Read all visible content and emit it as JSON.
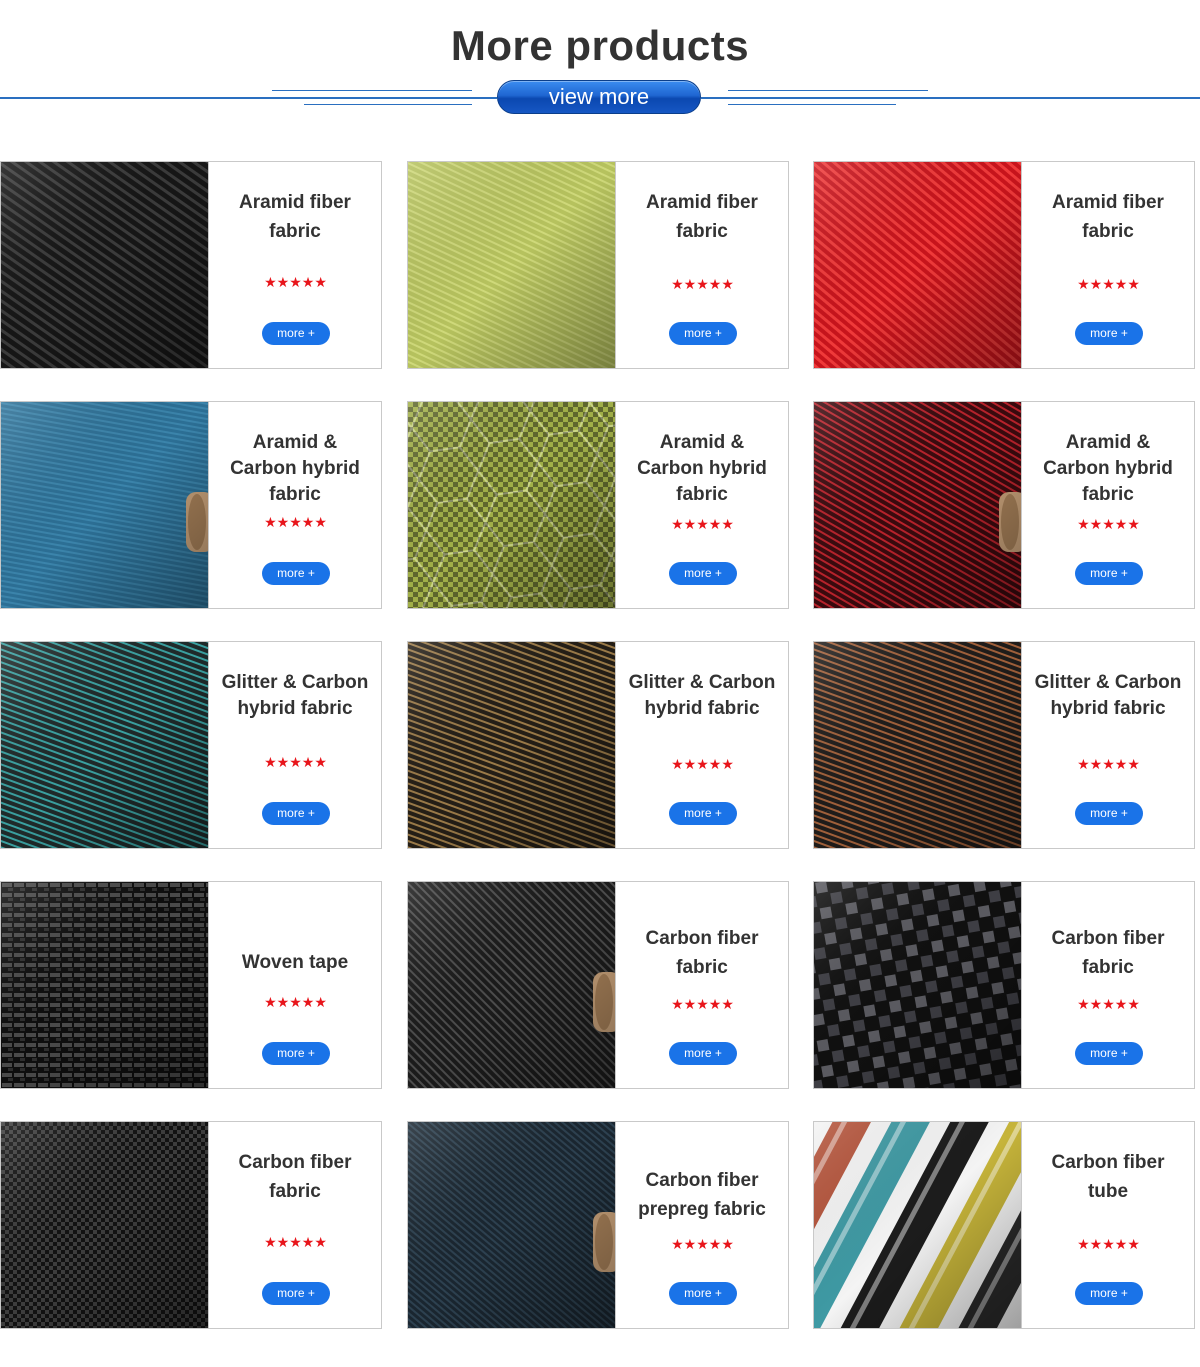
{
  "header": {
    "title": "More products",
    "view_more_label": "view more",
    "accent_color": "#2a6fc0"
  },
  "products": [
    {
      "name": "Aramid fiber fabric",
      "rating_stars": "★★★★★",
      "more_label": "more +",
      "swatch": "black-carbon-twill"
    },
    {
      "name": "Aramid fiber fabric",
      "rating_stars": "★★★★★",
      "more_label": "more +",
      "swatch": "yellow-green-aramid"
    },
    {
      "name": "Aramid fiber fabric",
      "rating_stars": "★★★★★",
      "more_label": "more +",
      "swatch": "red-aramid-twill"
    },
    {
      "name": "Aramid & Carbon hybrid fabric",
      "rating_stars": "★★★★★",
      "more_label": "more +",
      "swatch": "blue-hybrid-roll"
    },
    {
      "name": "Aramid & Carbon hybrid fabric",
      "rating_stars": "★★★★★",
      "more_label": "more +",
      "swatch": "yellow-hexagon-hybrid"
    },
    {
      "name": "Aramid & Carbon hybrid fabric",
      "rating_stars": "★★★★★",
      "more_label": "more +",
      "swatch": "red-black-hybrid-roll"
    },
    {
      "name": "Glitter & Carbon hybrid fabric",
      "rating_stars": "★★★★★",
      "more_label": "more +",
      "swatch": "teal-glitter-roll"
    },
    {
      "name": "Glitter & Carbon hybrid fabric",
      "rating_stars": "★★★★★",
      "more_label": "more +",
      "swatch": "gold-glitter-roll"
    },
    {
      "name": "Glitter & Carbon hybrid fabric",
      "rating_stars": "★★★★★",
      "more_label": "more +",
      "swatch": "copper-glitter-roll"
    },
    {
      "name": "Woven tape",
      "rating_stars": "★★★★★",
      "more_label": "more +",
      "swatch": "black-woven-tape"
    },
    {
      "name": "Carbon fiber fabric",
      "rating_stars": "★★★★★",
      "more_label": "more +",
      "swatch": "black-carbon-roll"
    },
    {
      "name": "Carbon fiber fabric",
      "rating_stars": "★★★★★",
      "more_label": "more +",
      "swatch": "spread-tow-carbon"
    },
    {
      "name": "Carbon fiber fabric",
      "rating_stars": "★★★★★",
      "more_label": "more +",
      "swatch": "black-carbon-plain"
    },
    {
      "name": "Carbon fiber prepreg fabric",
      "rating_stars": "★★★★★",
      "more_label": "more +",
      "swatch": "prepreg-roll"
    },
    {
      "name": "Carbon fiber tube",
      "rating_stars": "★★★★★",
      "more_label": "more +",
      "swatch": "colored-tubes"
    }
  ]
}
